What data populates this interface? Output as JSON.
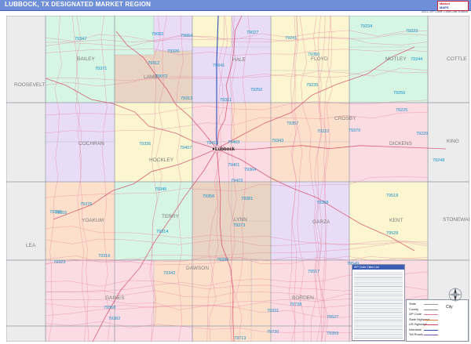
{
  "title": "LUBBOCK, TX DESIGNATED MARKET REGION",
  "edition": "2022 ZIP Code ColorCast Edition",
  "brand": {
    "line1": "Market",
    "line2": "MAPS"
  },
  "legend": {
    "title": "ZIP Code Cities List"
  },
  "key": {
    "rows": [
      {
        "label": "State",
        "color": "#9a9a9a"
      },
      {
        "label": "County",
        "color": "#8c8c8c"
      },
      {
        "label": "ZIP Code",
        "color": "#e07aa0"
      },
      {
        "label": "State Highways",
        "color": "#d47a3c"
      },
      {
        "label": "US Highways",
        "color": "#d24060"
      },
      {
        "label": "Interstate",
        "color": "#2b4fb5"
      },
      {
        "label": "Toll Roads",
        "color": "#7a4fb5"
      }
    ],
    "city_label": "City"
  },
  "colors": {
    "mint": "#d6f5e3",
    "tan": "#e9d3c2",
    "lavender": "#e8dcf6",
    "yellow": "#fbf6cf",
    "pink": "#fbdce4",
    "peach": "#fde0cc",
    "cyan": "#d2f3f2",
    "outside": "#ececec",
    "county_line": "#9ea3ad",
    "zip_label": "#1591c9",
    "county_label": "#7c7c7c",
    "road": "#e27a9c",
    "interstate": "#2b4fb5"
  },
  "counties": [
    "BAILEY",
    "LAMB",
    "HALE",
    "FLOYD",
    "MOTLEY",
    "COTTLE",
    "ROOSEVELT",
    "COCHRAN",
    "HOCKLEY",
    "CROSBY",
    "DICKENS",
    "KING",
    "YOAKUM",
    "TERRY",
    "LYNN",
    "GARZA",
    "KENT",
    "STONEWALL",
    "LEA",
    "GAINES",
    "DAWSON",
    "BORDEN"
  ],
  "city": "Lubbock",
  "zip_codes": [
    "79347",
    "79082",
    "79064",
    "79027",
    "79241",
    "79234",
    "79223",
    "79244",
    "79371",
    "79312",
    "79326",
    "79041",
    "79072",
    "79350",
    "79235",
    "79256",
    "79313",
    "79311",
    "79250",
    "79322",
    "79343",
    "79225",
    "79229",
    "79403",
    "79336",
    "79407",
    "79416",
    "79401",
    "79364",
    "79357",
    "79370",
    "79248",
    "79345",
    "79358",
    "79423",
    "79381",
    "79356",
    "79518",
    "79376",
    "79355",
    "79373",
    "79314",
    "79316",
    "79330",
    "79528",
    "79323",
    "79342",
    "79517",
    "79360",
    "79331",
    "79738",
    "79713",
    "79720",
    "79527",
    "79359",
    "79549",
    "79382",
    "79336"
  ]
}
